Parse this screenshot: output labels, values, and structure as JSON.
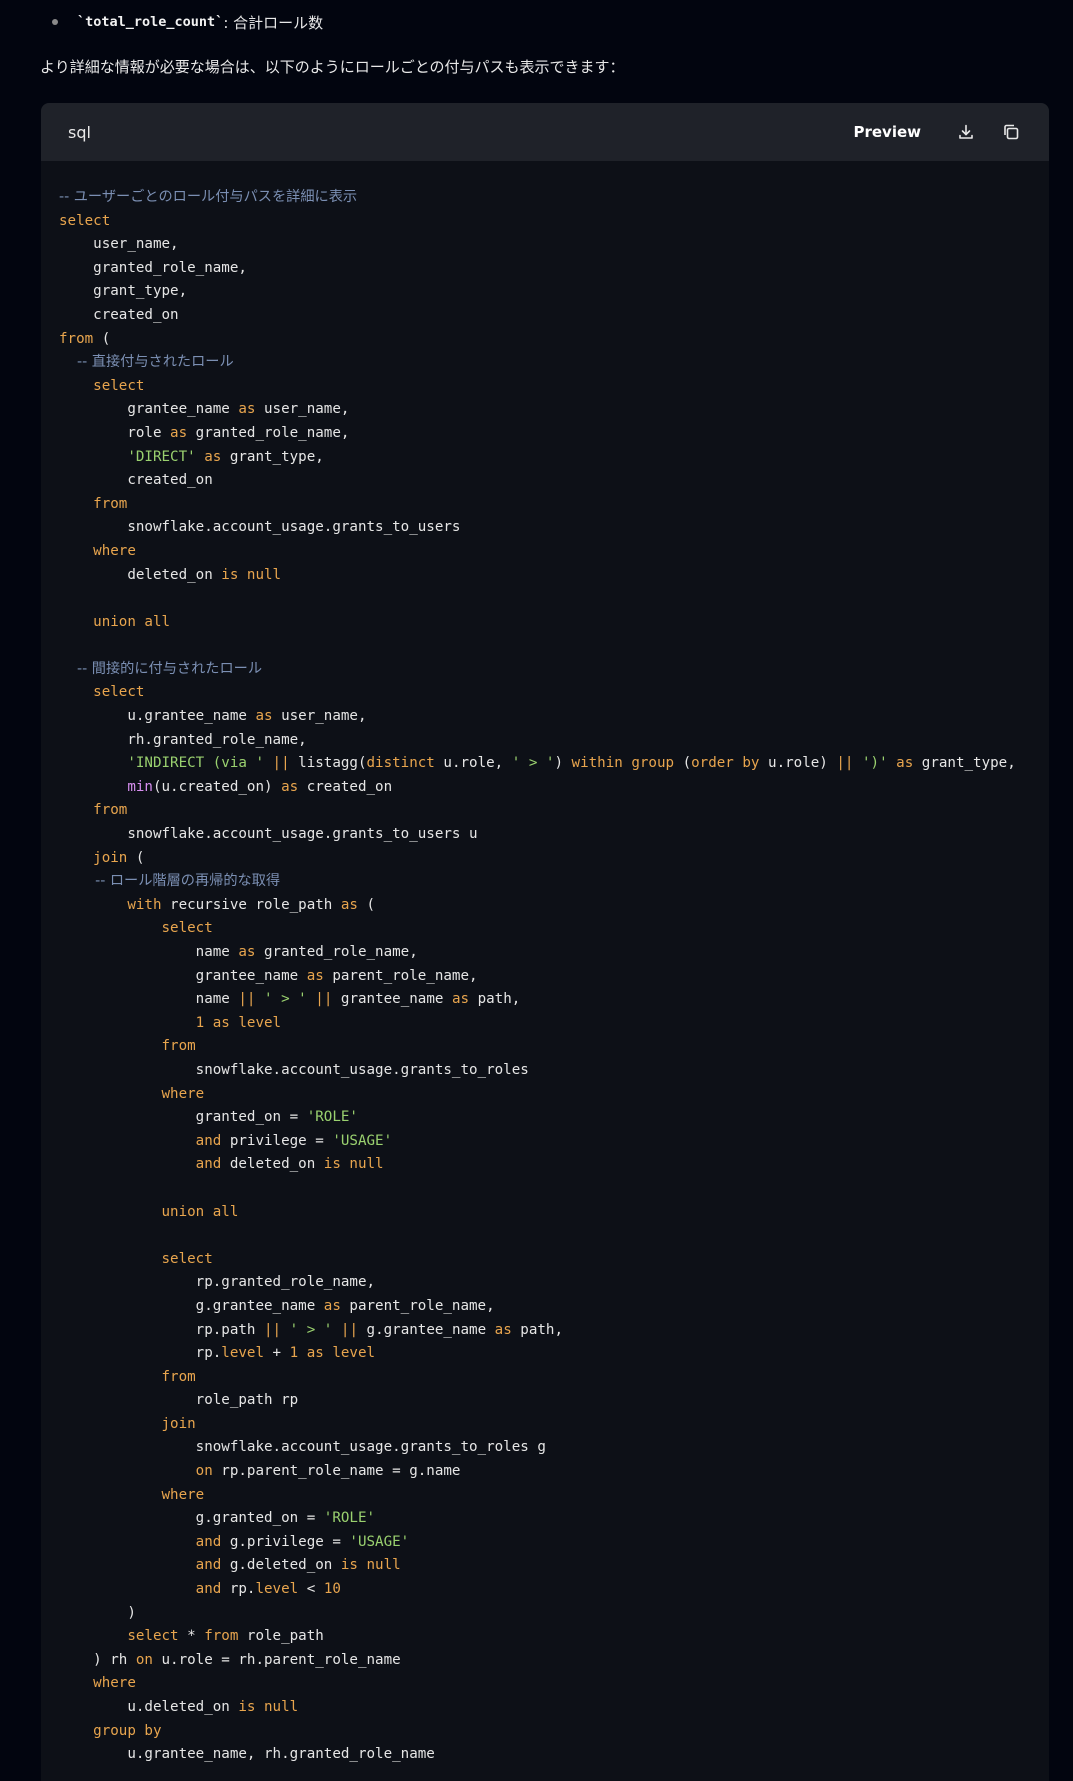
{
  "bullet": {
    "code": "`total_role_count`",
    "text": ": 合計ロール数"
  },
  "intro": "より詳細な情報が必要な場合は、以下のようにロールごとの付与パスも表示できます：",
  "code_block": {
    "language": "sql",
    "preview_label": "Preview",
    "download_icon": "download-icon",
    "copy_icon": "copy-icon",
    "lines": [
      [
        [
          "c",
          "-- ユーザーごとのロール付与パスを詳細に表示"
        ]
      ],
      [
        [
          "k",
          "select"
        ]
      ],
      [
        [
          "p",
          "    user_name,"
        ]
      ],
      [
        [
          "p",
          "    granted_role_name,"
        ]
      ],
      [
        [
          "p",
          "    grant_type,"
        ]
      ],
      [
        [
          "p",
          "    created_on"
        ]
      ],
      [
        [
          "k",
          "from"
        ],
        [
          "p",
          " ("
        ]
      ],
      [
        [
          "c",
          "    -- 直接付与されたロール"
        ]
      ],
      [
        [
          "k",
          "    select"
        ]
      ],
      [
        [
          "p",
          "        grantee_name "
        ],
        [
          "k",
          "as"
        ],
        [
          "p",
          " user_name,"
        ]
      ],
      [
        [
          "p",
          "        role "
        ],
        [
          "k",
          "as"
        ],
        [
          "p",
          " granted_role_name,"
        ]
      ],
      [
        [
          "s",
          "        'DIRECT'"
        ],
        [
          "p",
          " "
        ],
        [
          "k",
          "as"
        ],
        [
          "p",
          " grant_type,"
        ]
      ],
      [
        [
          "p",
          "        created_on"
        ]
      ],
      [
        [
          "k",
          "    from"
        ]
      ],
      [
        [
          "p",
          "        snowflake.account_usage.grants_to_users"
        ]
      ],
      [
        [
          "k",
          "    where"
        ]
      ],
      [
        [
          "p",
          "        deleted_on "
        ],
        [
          "k",
          "is null"
        ]
      ],
      [
        [
          "p",
          ""
        ]
      ],
      [
        [
          "k",
          "    union all"
        ]
      ],
      [
        [
          "p",
          ""
        ]
      ],
      [
        [
          "c",
          "    -- 間接的に付与されたロール"
        ]
      ],
      [
        [
          "k",
          "    select"
        ]
      ],
      [
        [
          "p",
          "        u.grantee_name "
        ],
        [
          "k",
          "as"
        ],
        [
          "p",
          " user_name,"
        ]
      ],
      [
        [
          "p",
          "        rh.granted_role_name,"
        ]
      ],
      [
        [
          "s",
          "        'INDIRECT (via '"
        ],
        [
          "p",
          " "
        ],
        [
          "k",
          "||"
        ],
        [
          "p",
          " listagg("
        ],
        [
          "k",
          "distinct"
        ],
        [
          "p",
          " u.role, "
        ],
        [
          "s",
          "' > '"
        ],
        [
          "p",
          ") "
        ],
        [
          "k",
          "within group"
        ],
        [
          "p",
          " ("
        ],
        [
          "k",
          "order by"
        ],
        [
          "p",
          " u.role) "
        ],
        [
          "k",
          "||"
        ],
        [
          "p",
          " "
        ],
        [
          "s",
          "')'"
        ],
        [
          "p",
          " "
        ],
        [
          "k",
          "as"
        ],
        [
          "p",
          " grant_type,"
        ]
      ],
      [
        [
          "f",
          "        min"
        ],
        [
          "p",
          "(u.created_on) "
        ],
        [
          "k",
          "as"
        ],
        [
          "p",
          " created_on"
        ]
      ],
      [
        [
          "k",
          "    from"
        ]
      ],
      [
        [
          "p",
          "        snowflake.account_usage.grants_to_users u"
        ]
      ],
      [
        [
          "k",
          "    join"
        ],
        [
          "p",
          " ("
        ]
      ],
      [
        [
          "c",
          "        -- ロール階層の再帰的な取得"
        ]
      ],
      [
        [
          "k",
          "        with"
        ],
        [
          "p",
          " recursive role_path "
        ],
        [
          "k",
          "as"
        ],
        [
          "p",
          " ("
        ]
      ],
      [
        [
          "k",
          "            select"
        ]
      ],
      [
        [
          "p",
          "                name "
        ],
        [
          "k",
          "as"
        ],
        [
          "p",
          " granted_role_name,"
        ]
      ],
      [
        [
          "p",
          "                grantee_name "
        ],
        [
          "k",
          "as"
        ],
        [
          "p",
          " parent_role_name,"
        ]
      ],
      [
        [
          "p",
          "                name "
        ],
        [
          "k",
          "||"
        ],
        [
          "p",
          " "
        ],
        [
          "s",
          "' > '"
        ],
        [
          "p",
          " "
        ],
        [
          "k",
          "||"
        ],
        [
          "p",
          " grantee_name "
        ],
        [
          "k",
          "as"
        ],
        [
          "p",
          " path,"
        ]
      ],
      [
        [
          "k",
          "                1 as level"
        ]
      ],
      [
        [
          "k",
          "            from"
        ]
      ],
      [
        [
          "p",
          "                snowflake.account_usage.grants_to_roles"
        ]
      ],
      [
        [
          "k",
          "            where"
        ]
      ],
      [
        [
          "p",
          "                granted_on = "
        ],
        [
          "s",
          "'ROLE'"
        ]
      ],
      [
        [
          "k",
          "                and"
        ],
        [
          "p",
          " privilege = "
        ],
        [
          "s",
          "'USAGE'"
        ]
      ],
      [
        [
          "k",
          "                and"
        ],
        [
          "p",
          " deleted_on "
        ],
        [
          "k",
          "is null"
        ]
      ],
      [
        [
          "p",
          ""
        ]
      ],
      [
        [
          "k",
          "            union all"
        ]
      ],
      [
        [
          "p",
          ""
        ]
      ],
      [
        [
          "k",
          "            select"
        ]
      ],
      [
        [
          "p",
          "                rp.granted_role_name,"
        ]
      ],
      [
        [
          "p",
          "                g.grantee_name "
        ],
        [
          "k",
          "as"
        ],
        [
          "p",
          " parent_role_name,"
        ]
      ],
      [
        [
          "p",
          "                rp.path "
        ],
        [
          "k",
          "||"
        ],
        [
          "p",
          " "
        ],
        [
          "s",
          "' > '"
        ],
        [
          "p",
          " "
        ],
        [
          "k",
          "||"
        ],
        [
          "p",
          " g.grantee_name "
        ],
        [
          "k",
          "as"
        ],
        [
          "p",
          " path,"
        ]
      ],
      [
        [
          "p",
          "                rp."
        ],
        [
          "k",
          "level"
        ],
        [
          "p",
          " + "
        ],
        [
          "k",
          "1 as level"
        ]
      ],
      [
        [
          "k",
          "            from"
        ]
      ],
      [
        [
          "p",
          "                role_path rp"
        ]
      ],
      [
        [
          "k",
          "            join"
        ]
      ],
      [
        [
          "p",
          "                snowflake.account_usage.grants_to_roles g"
        ]
      ],
      [
        [
          "k",
          "                on"
        ],
        [
          "p",
          " rp.parent_role_name = g.name"
        ]
      ],
      [
        [
          "k",
          "            where"
        ]
      ],
      [
        [
          "p",
          "                g.granted_on = "
        ],
        [
          "s",
          "'ROLE'"
        ]
      ],
      [
        [
          "k",
          "                and"
        ],
        [
          "p",
          " g.privilege = "
        ],
        [
          "s",
          "'USAGE'"
        ]
      ],
      [
        [
          "k",
          "                and"
        ],
        [
          "p",
          " g.deleted_on "
        ],
        [
          "k",
          "is null"
        ]
      ],
      [
        [
          "k",
          "                and"
        ],
        [
          "p",
          " rp."
        ],
        [
          "k",
          "level"
        ],
        [
          "p",
          " < "
        ],
        [
          "k",
          "10"
        ]
      ],
      [
        [
          "p",
          "        )"
        ]
      ],
      [
        [
          "k",
          "        select"
        ],
        [
          "p",
          " * "
        ],
        [
          "k",
          "from"
        ],
        [
          "p",
          " role_path"
        ]
      ],
      [
        [
          "p",
          "    ) rh "
        ],
        [
          "k",
          "on"
        ],
        [
          "p",
          " u.role = rh.parent_role_name"
        ]
      ],
      [
        [
          "k",
          "    where"
        ]
      ],
      [
        [
          "p",
          "        u.deleted_on "
        ],
        [
          "k",
          "is null"
        ]
      ],
      [
        [
          "k",
          "    group by"
        ]
      ],
      [
        [
          "p",
          "        u.grantee_name, rh.granted_role_name"
        ]
      ]
    ]
  }
}
